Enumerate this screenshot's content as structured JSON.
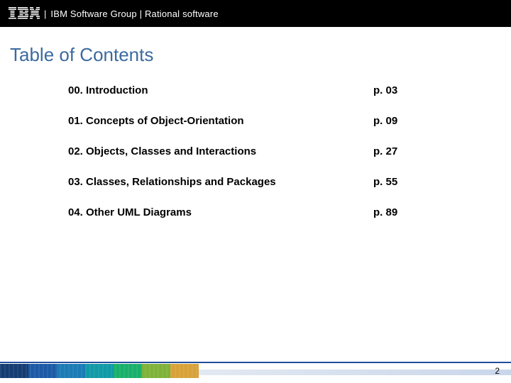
{
  "header": {
    "logo_label": "IBM",
    "text": "IBM Software Group | Rational software"
  },
  "title": "Table of Contents",
  "toc": [
    {
      "title": "00. Introduction",
      "page": "p. 03"
    },
    {
      "title": "01. Concepts of Object-Orientation",
      "page": "p. 09"
    },
    {
      "title": "02. Objects, Classes and Interactions",
      "page": "p. 27"
    },
    {
      "title": "03. Classes, Relationships and Packages",
      "page": "p. 55"
    },
    {
      "title": "04. Other UML Diagrams",
      "page": "p. 89"
    }
  ],
  "page_number": "2"
}
